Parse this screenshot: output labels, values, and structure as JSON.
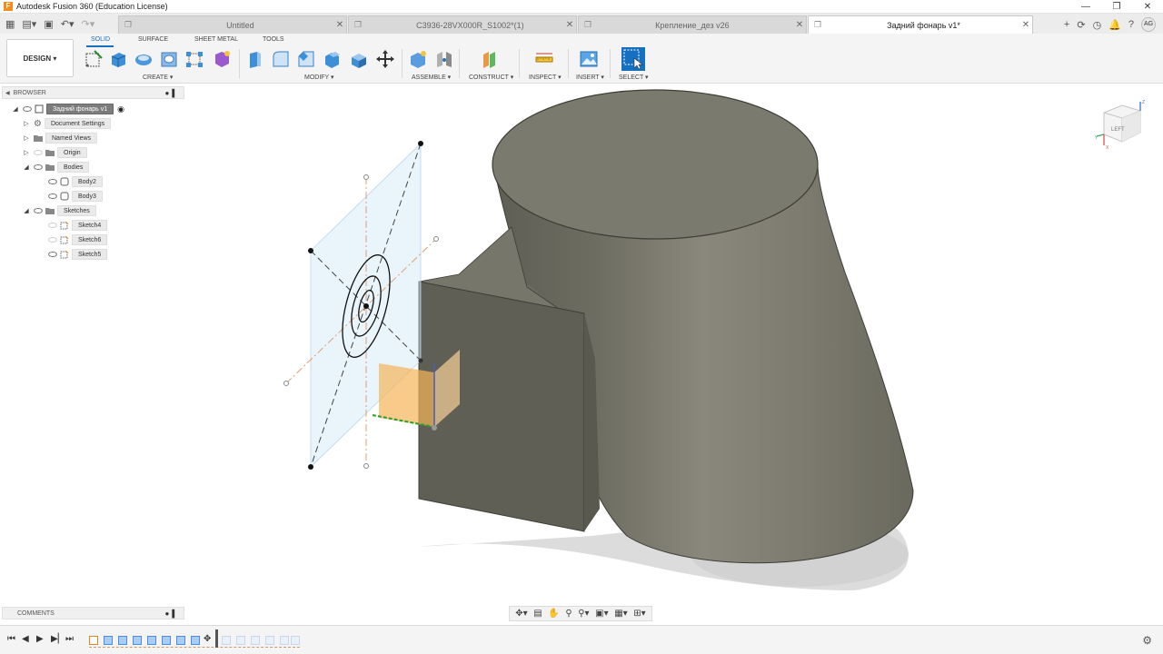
{
  "window": {
    "title": "Autodesk Fusion 360 (Education License)",
    "controls": [
      "—",
      "❐",
      "✕"
    ]
  },
  "tabs": [
    {
      "label": "Untitled",
      "active": false
    },
    {
      "label": "C3936-28VX000R_S1002*(1)",
      "active": false
    },
    {
      "label": "Крепление_дез v26",
      "active": false
    },
    {
      "label": "Задний фонарь v1*",
      "active": true
    }
  ],
  "user": {
    "initials": "AG"
  },
  "toolbar": {
    "workspace": "DESIGN ▾",
    "tabs": [
      "SOLID",
      "SURFACE",
      "SHEET METAL",
      "TOOLS"
    ],
    "groups": {
      "create": "CREATE ▾",
      "modify": "MODIFY ▾",
      "assemble": "ASSEMBLE ▾",
      "construct": "CONSTRUCT ▾",
      "inspect": "INSPECT ▾",
      "insert": "INSERT ▾",
      "select": "SELECT ▾"
    }
  },
  "browser": {
    "title": "BROWSER",
    "items": [
      {
        "label": "Задний фонарь v1"
      },
      {
        "label": "Document Settings"
      },
      {
        "label": "Named Views"
      },
      {
        "label": "Origin"
      },
      {
        "label": "Bodies"
      },
      {
        "label": "Body2"
      },
      {
        "label": "Body3"
      },
      {
        "label": "Sketches"
      },
      {
        "label": "Sketch4"
      },
      {
        "label": "Sketch6"
      },
      {
        "label": "Sketch5"
      }
    ]
  },
  "comments": {
    "title": "COMMENTS"
  },
  "viewcube": {
    "face_label": "LEFT",
    "axes": {
      "x": "X",
      "y": "Y",
      "z": "Z"
    }
  },
  "colors": {
    "accent": "#1670c0",
    "body": "#7d7b6f",
    "plane": "#cfe6f7",
    "sketch_profile": "#f5b55a"
  }
}
